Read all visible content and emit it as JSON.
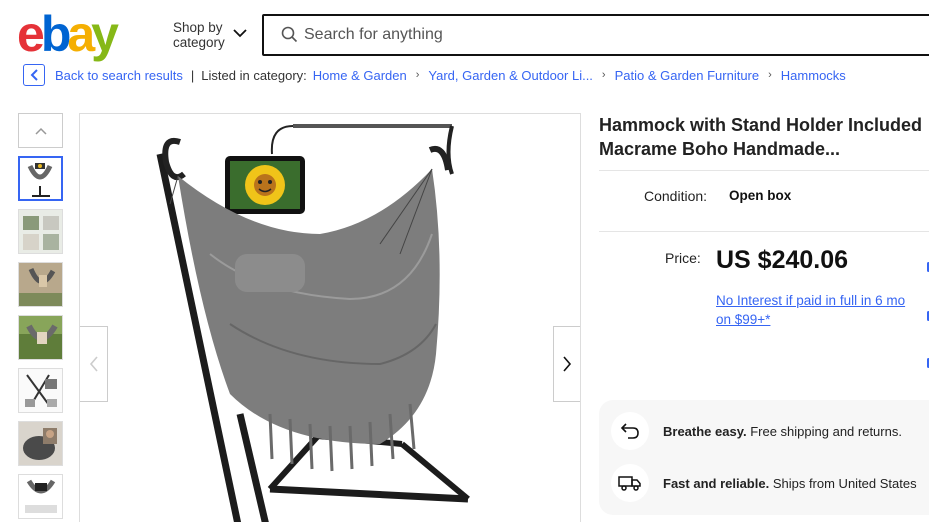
{
  "header": {
    "logo_letters": [
      "e",
      "b",
      "a",
      "y"
    ],
    "logo_colors": [
      "#e53238",
      "#0064d2",
      "#f5af02",
      "#86b817"
    ],
    "shop_by_line1": "Shop by",
    "shop_by_line2": "category",
    "search_placeholder": "Search for anything"
  },
  "breadcrumb": {
    "back_label": "Back to search results",
    "listed_label": "Listed in category:",
    "items": [
      "Home & Garden",
      "Yard, Garden & Outdoor Li...",
      "Patio & Garden Furniture",
      "Hammocks"
    ]
  },
  "gallery": {
    "thumbnail_count": 7,
    "active_index": 0
  },
  "listing": {
    "title": "Hammock with Stand Holder Included Macrame Boho Handmade...",
    "condition_label": "Condition:",
    "condition_value": "Open box",
    "price_label": "Price:",
    "price": "US $240.06",
    "finance_text": "No Interest if paid in full in 6 mo on $99+*"
  },
  "promos": [
    {
      "icon": "return-arrow-icon",
      "bold": "Breathe easy.",
      "text": " Free shipping and returns."
    },
    {
      "icon": "delivery-truck-icon",
      "bold": "Fast and reliable.",
      "text": " Ships from United States"
    }
  ],
  "colors": {
    "link": "#3665f3",
    "accent": "#3665f3"
  }
}
